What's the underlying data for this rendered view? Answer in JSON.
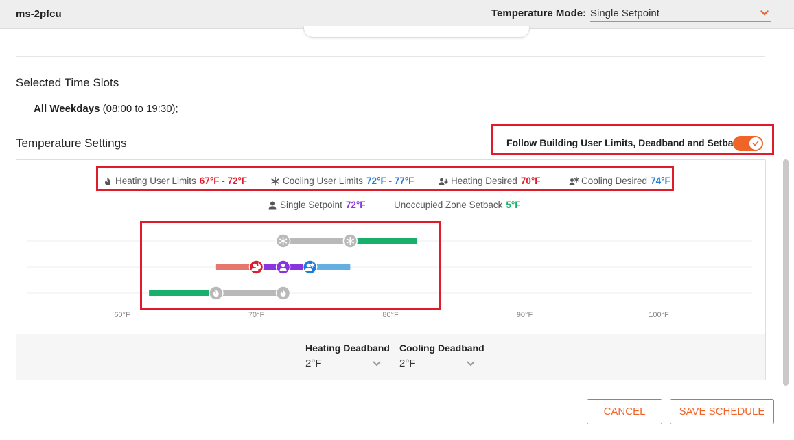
{
  "header": {
    "device_name": "ms-2pfcu",
    "mode_label": "Temperature Mode:",
    "mode_value": "Single Setpoint"
  },
  "time_slots": {
    "title": "Selected Time Slots",
    "entries": [
      {
        "days": "All Weekdays",
        "range": "(08:00 to 19:30);"
      }
    ]
  },
  "temperature_settings": {
    "title": "Temperature Settings",
    "follow_label": "Follow Building User Limits, Deadband and Setback",
    "follow_enabled": true
  },
  "legend": {
    "heating_limits": {
      "label": "Heating User Limits",
      "value": "67°F - 72°F"
    },
    "cooling_limits": {
      "label": "Cooling User Limits",
      "value": "72°F - 77°F"
    },
    "heating_desired": {
      "label": "Heating Desired",
      "value": "70°F"
    },
    "cooling_desired": {
      "label": "Cooling Desired",
      "value": "74°F"
    },
    "single_setpoint": {
      "label": "Single Setpoint",
      "value": "72°F"
    },
    "setback": {
      "label": "Unoccupied Zone Setback",
      "value": "5°F"
    }
  },
  "scale": {
    "ticks": [
      "60°F",
      "70°F",
      "80°F",
      "90°F",
      "100°F"
    ],
    "tick_values": [
      60,
      70,
      80,
      90,
      100
    ]
  },
  "slider_levels": {
    "cooling_row": {
      "setback_from_f": 77,
      "setback_to_f": 82,
      "limit_from_f": 72,
      "limit_to_f": 77
    },
    "desired_row": {
      "heat_range_from_f": 67,
      "heat_range_to_f": 70,
      "setpoint_range_from_f": 70,
      "setpoint_range_to_f": 74,
      "cool_range_from_f": 74,
      "cool_range_to_f": 77,
      "heating_desired_f": 70,
      "setpoint_f": 72,
      "cooling_desired_f": 74
    },
    "heating_row": {
      "setback_from_f": 62,
      "setback_to_f": 67,
      "limit_from_f": 67,
      "limit_to_f": 72
    }
  },
  "deadband": {
    "heating_label": "Heating Deadband",
    "heating_value": "2°F",
    "cooling_label": "Cooling Deadband",
    "cooling_value": "2°F"
  },
  "buttons": {
    "cancel": "CANCEL",
    "save": "SAVE SCHEDULE"
  },
  "colors": {
    "accent": "#f06428",
    "heating": "#e11c2a",
    "cooling": "#1f7bd8",
    "setpoint": "#8a34e0",
    "setback": "#18b06a"
  }
}
